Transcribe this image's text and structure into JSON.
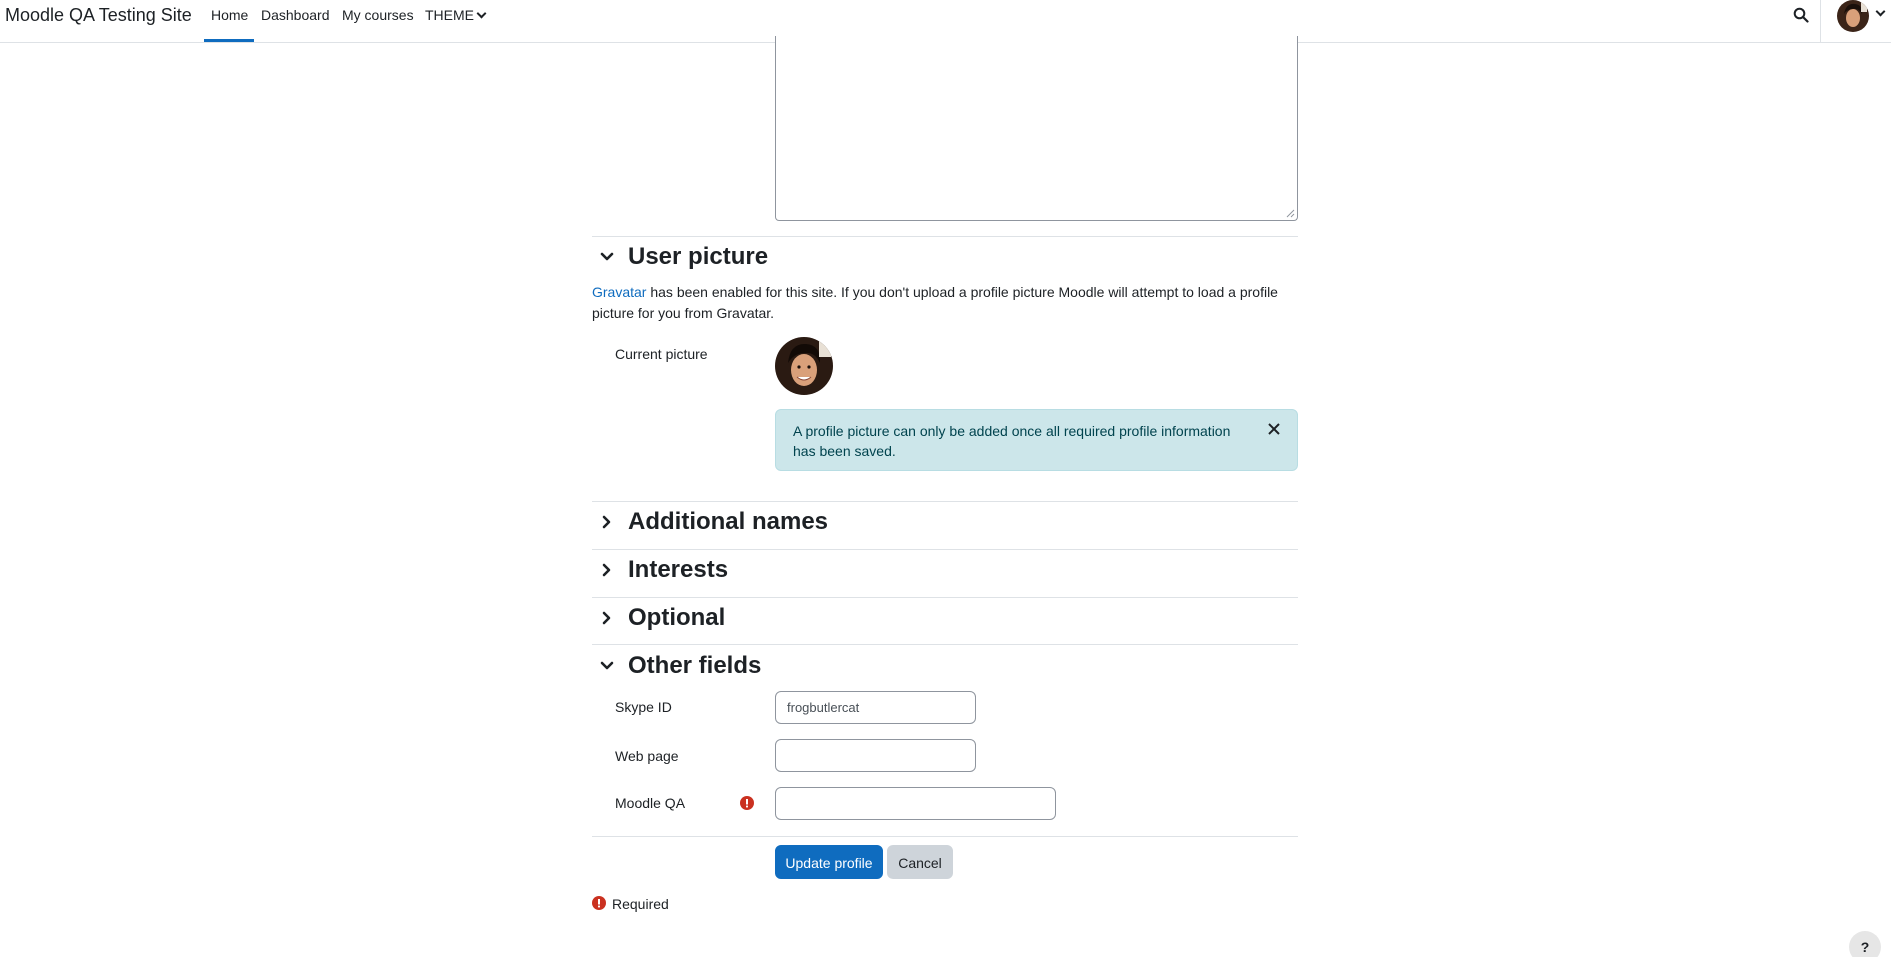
{
  "navbar": {
    "brand": "Moodle QA Testing Site",
    "items": [
      {
        "label": "Home"
      },
      {
        "label": "Dashboard"
      },
      {
        "label": "My courses"
      },
      {
        "label": "THEME"
      }
    ]
  },
  "user_picture": {
    "title": "User picture",
    "gravatar_link": "Gravatar",
    "gravatar_text": " has been enabled for this site. If you don't upload a profile picture Moodle will attempt to load a profile picture for you from Gravatar.",
    "current_picture_label": "Current picture",
    "alert_text": "A profile picture can only be added once all required profile information has been saved."
  },
  "sections": {
    "additional_names": "Additional names",
    "interests": "Interests",
    "optional": "Optional",
    "other_fields": "Other fields"
  },
  "other_fields": {
    "skype_label": "Skype ID",
    "skype_value": "frogbutlercat",
    "webpage_label": "Web page",
    "webpage_value": "",
    "moodleqa_label": "Moodle QA",
    "moodleqa_value": ""
  },
  "buttons": {
    "update": "Update profile",
    "cancel": "Cancel"
  },
  "required_note": "Required",
  "help_label": "?",
  "colors": {
    "primary": "#0f6cbf",
    "danger": "#ca3120",
    "info_bg": "#cce6ea"
  }
}
